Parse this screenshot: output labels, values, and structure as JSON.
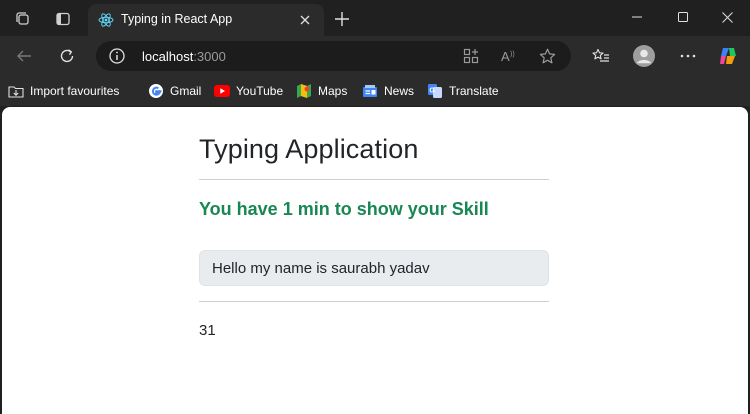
{
  "browser": {
    "tab_title": "Typing in React App",
    "url_host": "localhost",
    "url_port": ":3000",
    "favourites": [
      {
        "label": "Import favourites",
        "icon": "import-icon"
      },
      {
        "label": "Gmail",
        "icon": "google-icon"
      },
      {
        "label": "YouTube",
        "icon": "youtube-icon"
      },
      {
        "label": "Maps",
        "icon": "maps-icon"
      },
      {
        "label": "News",
        "icon": "news-icon"
      },
      {
        "label": "Translate",
        "icon": "translate-icon"
      }
    ],
    "accent_color": "#1a73e8"
  },
  "app": {
    "title": "Typing Application",
    "subtitle": "You have 1 min to show your Skill",
    "subtitle_color": "#198754",
    "input_value": "Hello my name is saurabh yadav",
    "timer": "31"
  }
}
